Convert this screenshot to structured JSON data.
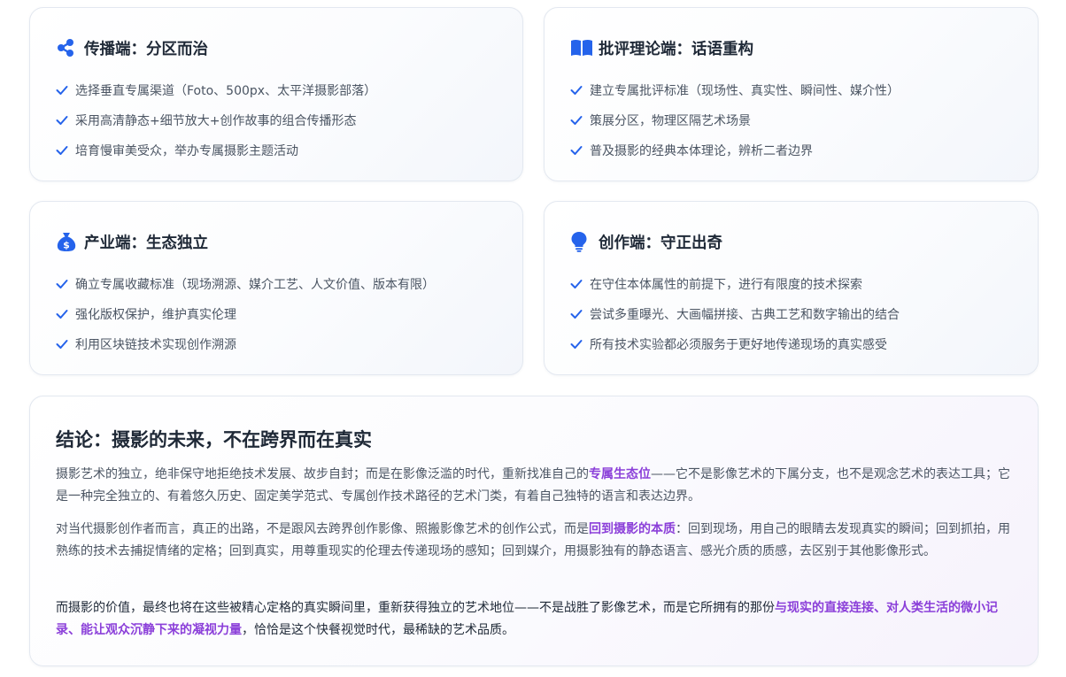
{
  "cards": [
    {
      "icon": "share-icon",
      "title": "传播端：分区而治",
      "items": [
        "选择垂直专属渠道（Foto、500px、太平洋摄影部落）",
        "采用高清静态+细节放大+创作故事的组合传播形态",
        "培育慢审美受众，举办专属摄影主题活动"
      ]
    },
    {
      "icon": "book-icon",
      "title": "批评理论端：话语重构",
      "items": [
        "建立专属批评标准（现场性、真实性、瞬间性、媒介性）",
        "策展分区，物理区隔艺术场景",
        "普及摄影的经典本体理论，辨析二者边界"
      ]
    },
    {
      "icon": "money-bag-icon",
      "title": "产业端：生态独立",
      "items": [
        "确立专属收藏标准（现场溯源、媒介工艺、人文价值、版本有限）",
        "强化版权保护，维护真实伦理",
        "利用区块链技术实现创作溯源"
      ]
    },
    {
      "icon": "lightbulb-icon",
      "title": "创作端：守正出奇",
      "items": [
        "在守住本体属性的前提下，进行有限度的技术探索",
        "尝试多重曝光、大画幅拼接、古典工艺和数字输出的结合",
        "所有技术实验都必须服务于更好地传递现场的真实感受"
      ]
    }
  ],
  "conclusion": {
    "title": "结论：摄影的未来，不在跨界而在真实",
    "p1": {
      "before": "摄影艺术的独立，绝非保守地拒绝技术发展、故步自封；而是在影像泛滥的时代，重新找准自己的",
      "highlight": "专属生态位",
      "after": "——它不是影像艺术的下属分支，也不是观念艺术的表达工具；它是一种完全独立的、有着悠久历史、固定美学范式、专属创作技术路径的艺术门类，有着自己独特的语言和表达边界。"
    },
    "p2": {
      "before": "对当代摄影创作者而言，真正的出路，不是跟风去跨界创作影像、照搬影像艺术的创作公式，而是",
      "highlight": "回到摄影的本质",
      "after": "：回到现场，用自己的眼睛去发现真实的瞬间；回到抓拍，用熟练的技术去捕捉情绪的定格；回到真实，用尊重现实的伦理去传递现场的感知；回到媒介，用摄影独有的静态语言、感光介质的质感，去区别于其他影像形式。"
    },
    "p3": {
      "before": "而摄影的价值，最终也将在这些被精心定格的真实瞬间里，重新获得独立的艺术地位——不是战胜了影像艺术，而是它所拥有的那份",
      "highlight": "与现实的直接连接、对人类生活的微小记录、能让观众沉静下来的凝视力量",
      "after": "，恰恰是这个快餐视觉时代，最稀缺的艺术品质。"
    }
  },
  "colors": {
    "accent_blue": "#2563eb",
    "highlight_purple": "#8b3fd9",
    "title_text": "#1f2937",
    "body_text": "#4b5563"
  }
}
